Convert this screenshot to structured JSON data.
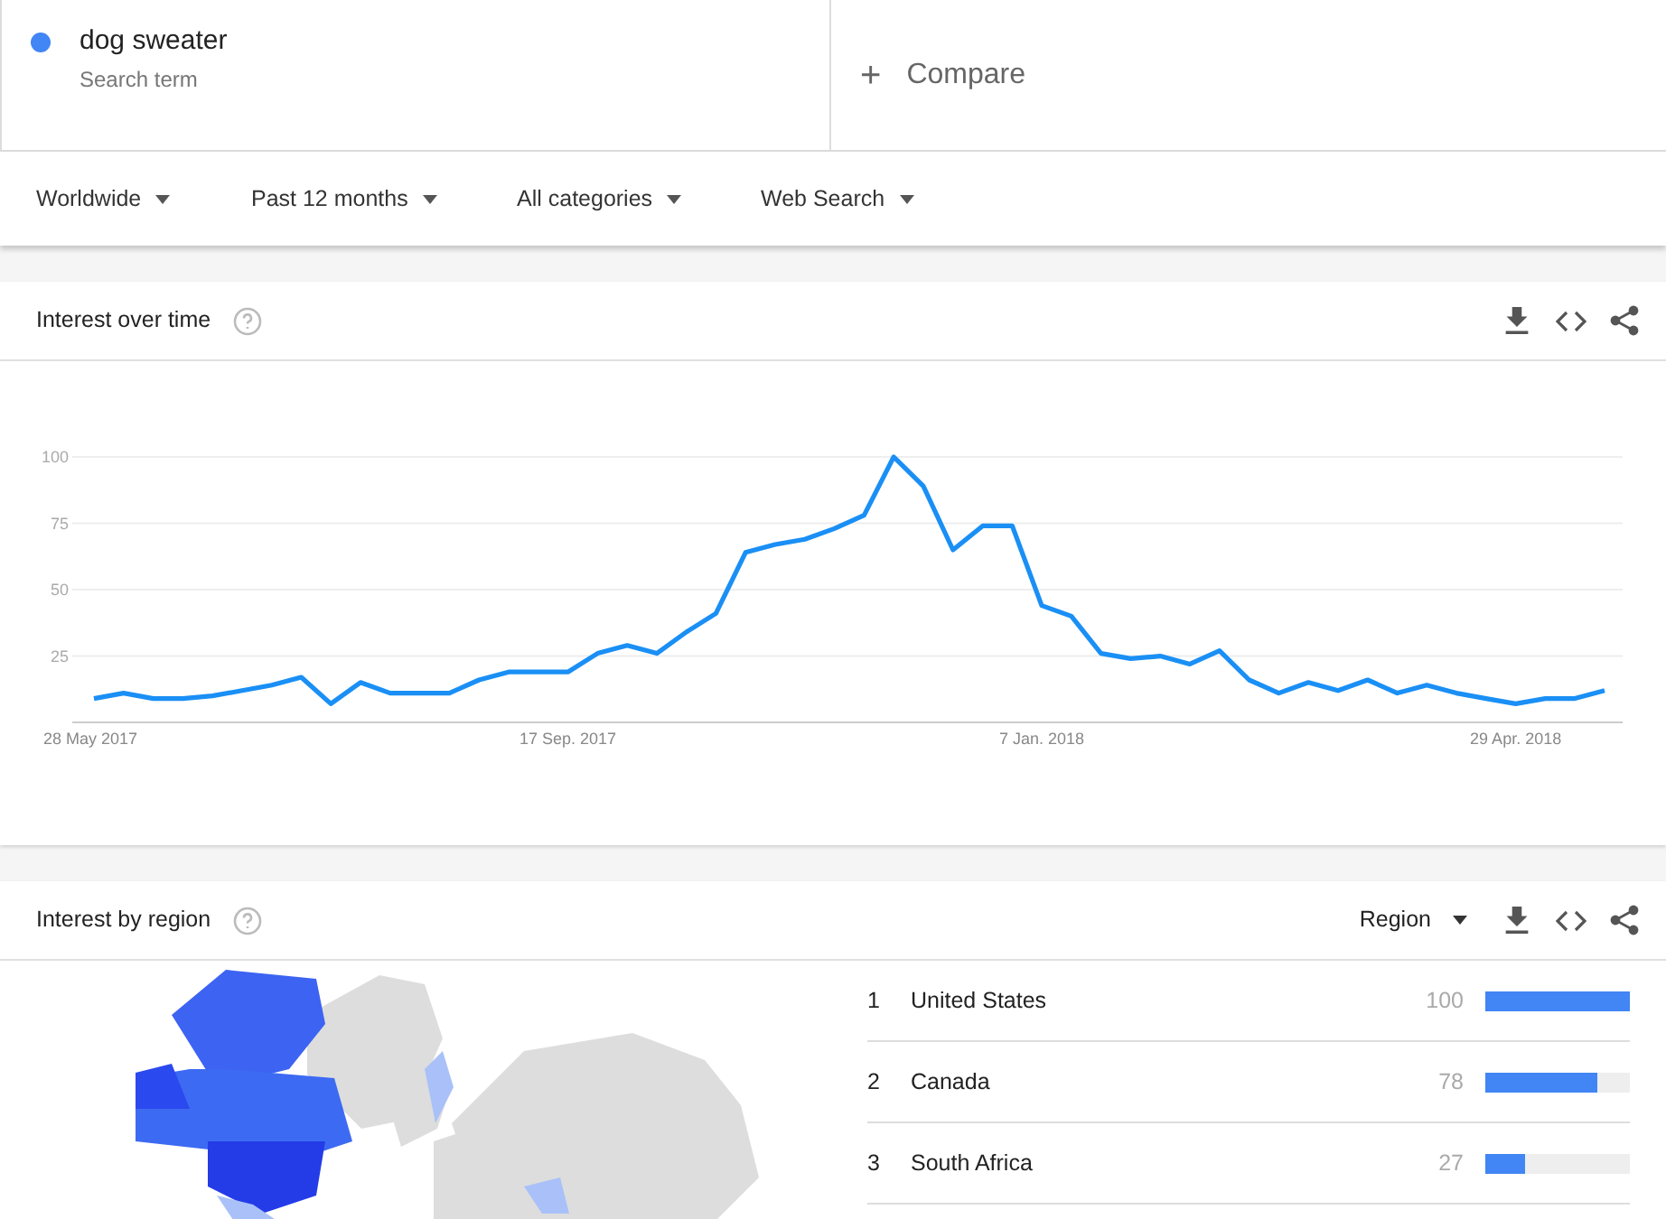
{
  "search_terms": [
    {
      "term": "dog sweater",
      "subtitle": "Search term",
      "color": "#4285f4"
    }
  ],
  "compare": {
    "icon": "+",
    "label": "Compare"
  },
  "filters": [
    "Worldwide",
    "Past 12 months",
    "All categories",
    "Web Search"
  ],
  "interest_over_time": {
    "title": "Interest over time",
    "chart_data": {
      "type": "line",
      "categories": [
        "28 May 2017",
        null,
        null,
        null,
        null,
        null,
        null,
        null,
        null,
        null,
        null,
        null,
        null,
        null,
        null,
        null,
        "17 Sep. 2017",
        null,
        null,
        null,
        null,
        null,
        null,
        null,
        null,
        null,
        null,
        null,
        null,
        null,
        null,
        null,
        "7 Jan. 2018",
        null,
        null,
        null,
        null,
        null,
        null,
        null,
        null,
        null,
        null,
        null,
        null,
        null,
        null,
        null,
        "29 Apr. 2018",
        null,
        null,
        null
      ],
      "series": [
        {
          "color": "#1a8ff5",
          "values": [
            9,
            11,
            9,
            9,
            10,
            12,
            14,
            17,
            7,
            15,
            11,
            11,
            11,
            16,
            19,
            19,
            19,
            26,
            29,
            26,
            34,
            41,
            64,
            67,
            69,
            73,
            78,
            100,
            89,
            65,
            74,
            74,
            44,
            40,
            26,
            24,
            25,
            22,
            27,
            16,
            11,
            15,
            12,
            16,
            11,
            14,
            11,
            9,
            7,
            9,
            9,
            12
          ]
        }
      ],
      "ylim": [
        0,
        100
      ],
      "yticks": [
        25,
        50,
        75,
        100
      ],
      "grid": true
    }
  },
  "interest_by_region": {
    "title": "Interest by region",
    "resolution": "Region",
    "regions": [
      {
        "rank": "1",
        "name": "United States",
        "value": "100",
        "level": 1.0
      },
      {
        "rank": "2",
        "name": "Canada",
        "value": "78",
        "level": 0.78
      },
      {
        "rank": "3",
        "name": "South Africa",
        "value": "27",
        "level": 0.27
      }
    ]
  }
}
